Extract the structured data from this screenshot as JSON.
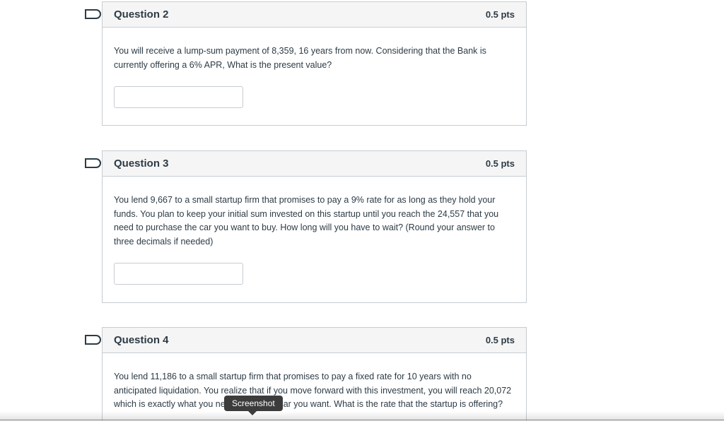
{
  "questions": [
    {
      "title": "Question 2",
      "points": "0.5 pts",
      "text": "You will receive a lump-sum payment of 8,359, 16 years from now. Considering that the Bank is currently offering a 6% APR, What is the present value?",
      "answer_value": ""
    },
    {
      "title": "Question 3",
      "points": "0.5 pts",
      "text": "You lend 9,667 to a small startup firm that promises to pay a 9% rate for as long as they hold your funds. You plan to keep your initial sum invested on this startup until you reach the 24,557 that you need to purchase the car you want to buy. How long will you have to wait? (Round your answer to three decimals if needed)",
      "answer_value": ""
    },
    {
      "title": "Question 4",
      "points": "0.5 pts",
      "text": "You lend 11,186 to a small startup firm that promises to pay a fixed rate for 10 years with no anticipated liquidation. You realize that if you move forward with this investment, you will reach 20,072 which is exactly what you need to buy the car you want. What is the rate that the startup is offering?"
    }
  ],
  "tooltip": {
    "label": "Screenshot"
  }
}
